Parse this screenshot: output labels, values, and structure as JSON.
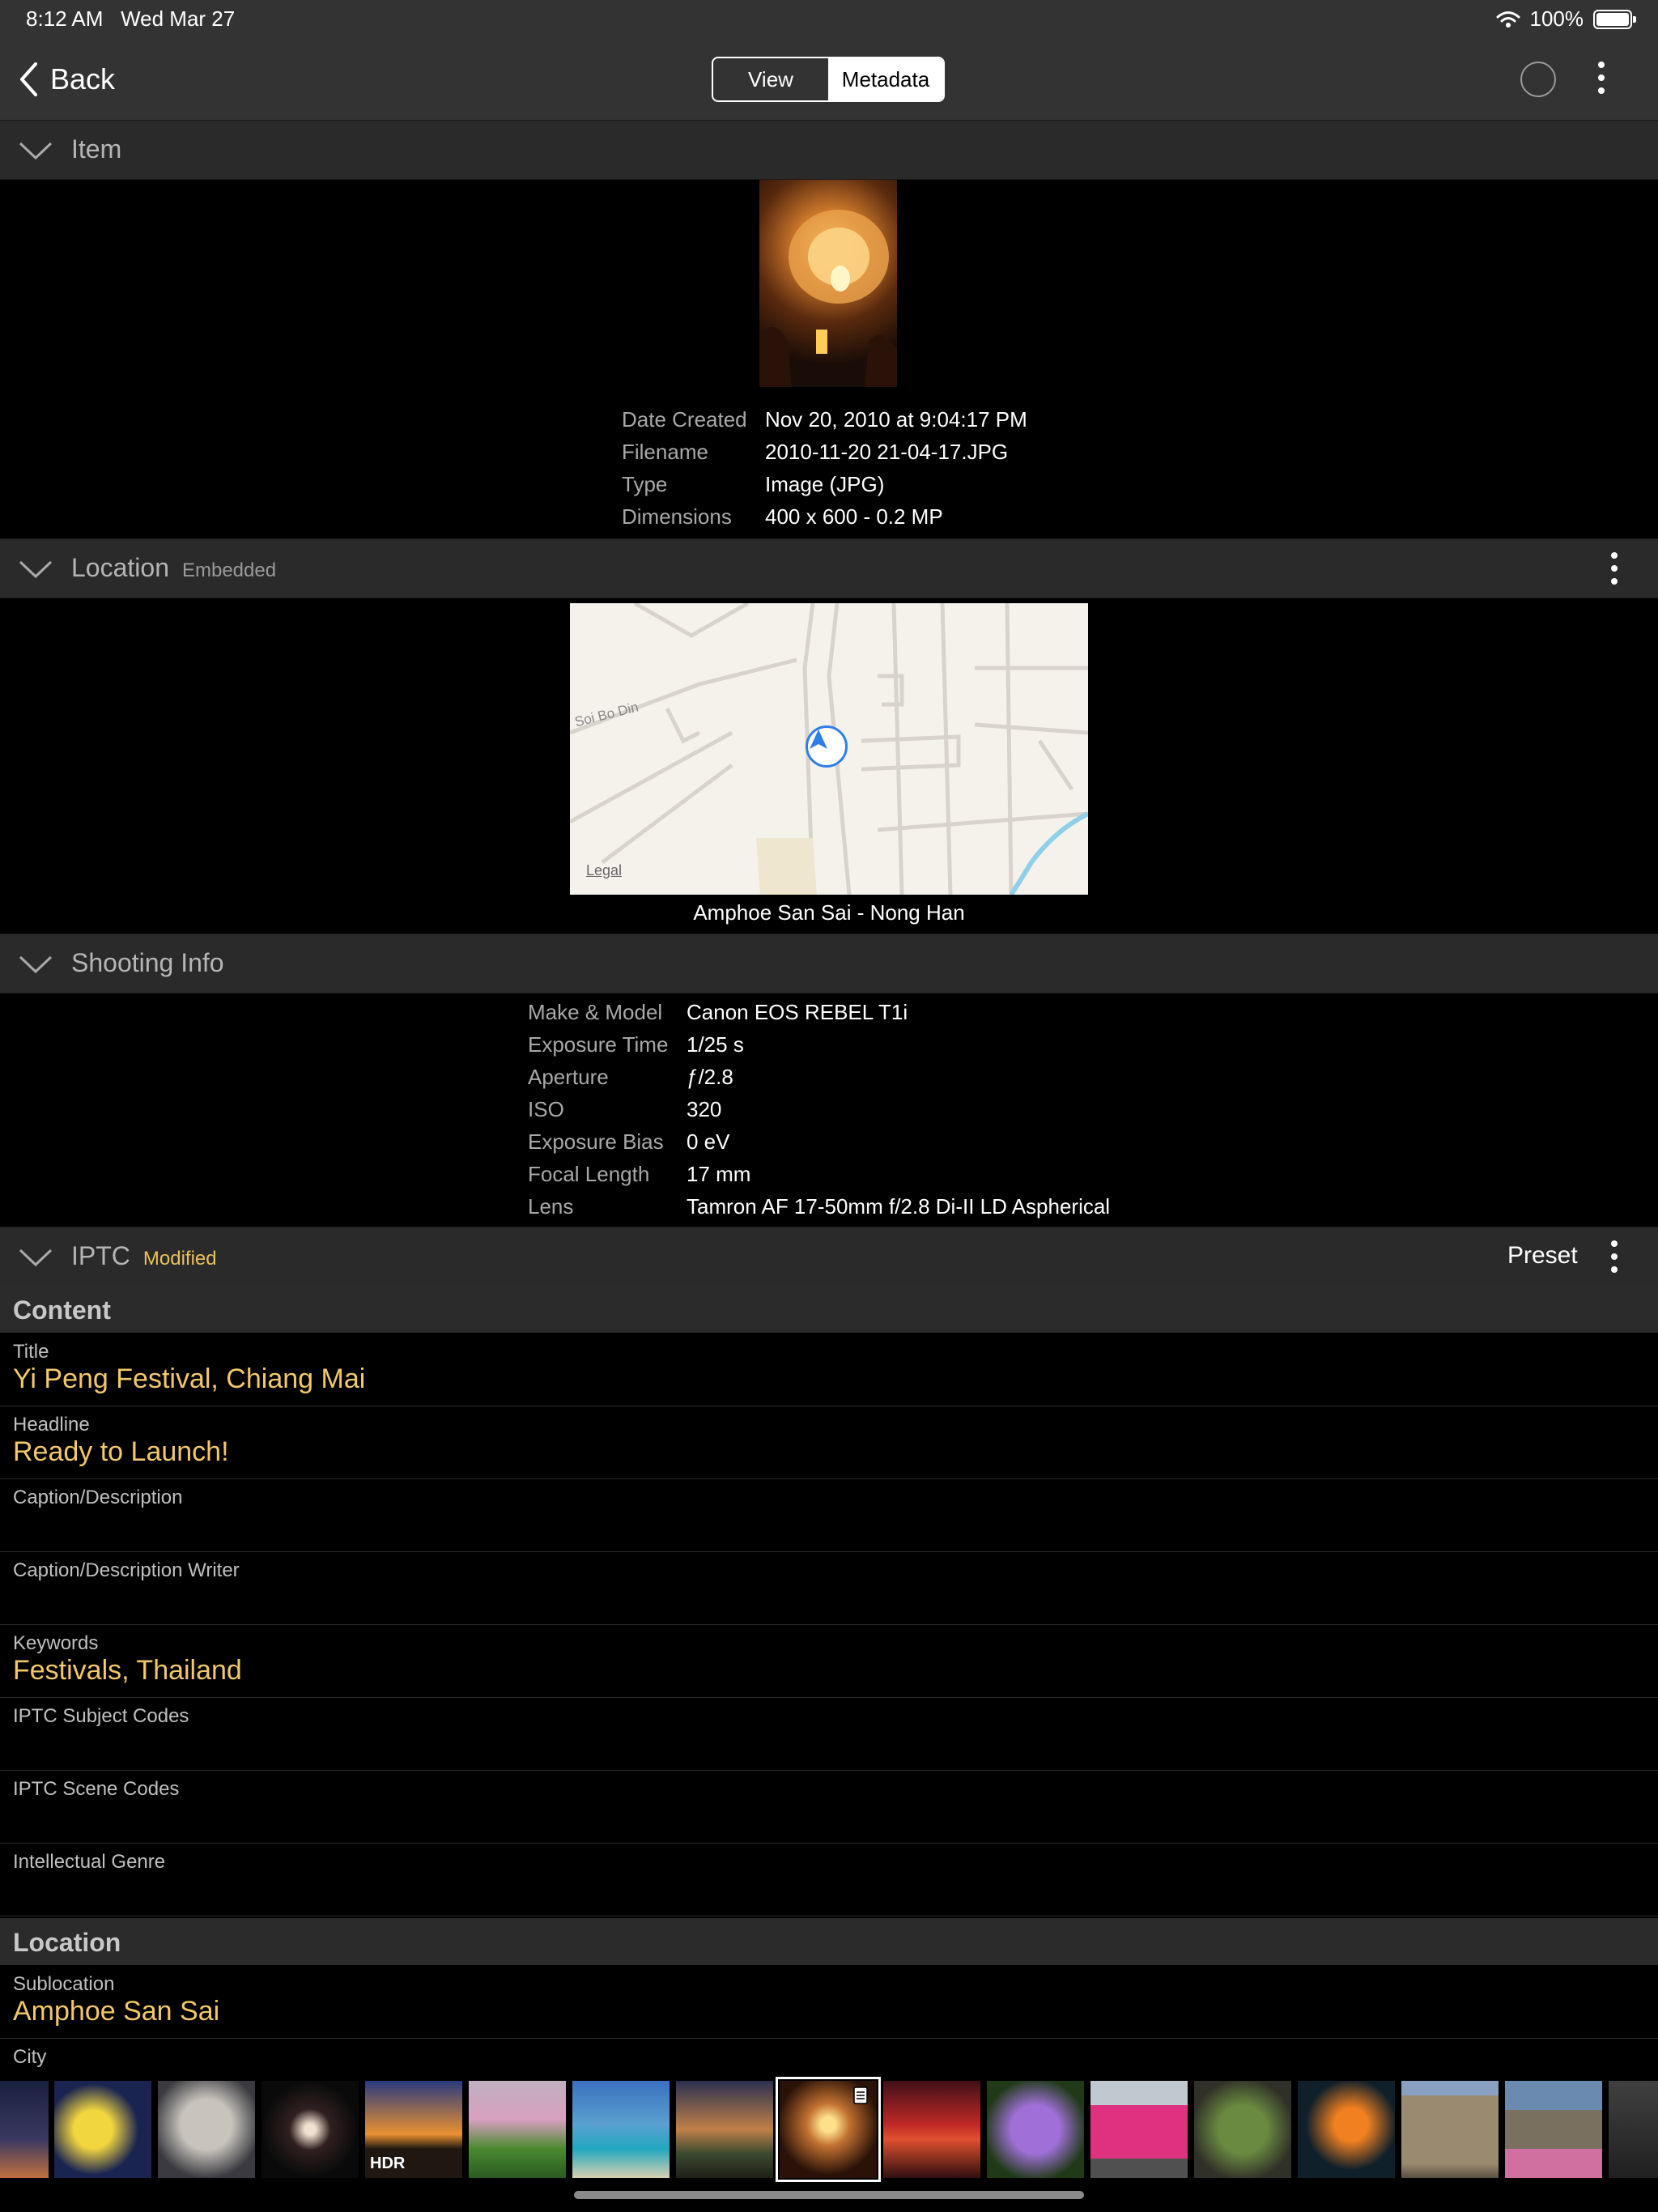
{
  "status_bar": {
    "time": "8:12 AM",
    "date": "Wed Mar 27",
    "battery": "100%"
  },
  "nav": {
    "back_label": "Back",
    "tabs": [
      "View",
      "Metadata"
    ],
    "active_tab": "Metadata"
  },
  "item_section": {
    "title": "Item",
    "rows": [
      {
        "key": "Date Created",
        "value": "Nov 20, 2010 at 9:04:17 PM"
      },
      {
        "key": "Filename",
        "value": "2010-11-20 21-04-17.JPG"
      },
      {
        "key": "Type",
        "value": "Image (JPG)"
      },
      {
        "key": "Dimensions",
        "value": "400 x 600 - 0.2 MP"
      }
    ]
  },
  "location_section": {
    "title": "Location",
    "badge": "Embedded",
    "map_street": "Soi Bo Din",
    "map_legal": "Legal",
    "place": "Amphoe San Sai - Nong Han"
  },
  "shooting_section": {
    "title": "Shooting Info",
    "rows": [
      {
        "key": "Make & Model",
        "value": "Canon EOS REBEL T1i"
      },
      {
        "key": "Exposure Time",
        "value": "1/25 s"
      },
      {
        "key": "Aperture",
        "value": "ƒ/2.8"
      },
      {
        "key": "ISO",
        "value": "320"
      },
      {
        "key": "Exposure Bias",
        "value": "0 eV"
      },
      {
        "key": "Focal Length",
        "value": "17 mm"
      },
      {
        "key": "Lens",
        "value": "Tamron AF 17-50mm f/2.8 Di-II LD Aspherical"
      }
    ]
  },
  "iptc_section": {
    "title": "IPTC",
    "badge": "Modified",
    "preset_label": "Preset",
    "groups": [
      {
        "name": "Content",
        "fields": [
          {
            "label": "Title",
            "value": "Yi Peng Festival, Chiang Mai"
          },
          {
            "label": "Headline",
            "value": "Ready to Launch!"
          },
          {
            "label": "Caption/Description",
            "value": ""
          },
          {
            "label": "Caption/Description Writer",
            "value": ""
          },
          {
            "label": "Keywords",
            "value": "Festivals, Thailand"
          },
          {
            "label": "IPTC Subject Codes",
            "value": ""
          },
          {
            "label": "IPTC Scene Codes",
            "value": ""
          },
          {
            "label": "Intellectual Genre",
            "value": ""
          }
        ]
      },
      {
        "name": "Location",
        "fields": [
          {
            "label": "Sublocation",
            "value": "Amphoe San Sai"
          },
          {
            "label": "City",
            "value": ""
          }
        ]
      }
    ]
  },
  "filmstrip": {
    "thumbnails": [
      {
        "name": "city-night",
        "badge": ""
      },
      {
        "name": "yellow-flowers",
        "badge": ""
      },
      {
        "name": "owl",
        "badge": ""
      },
      {
        "name": "light-painting",
        "badge": ""
      },
      {
        "name": "sunset-hdr",
        "badge": "HDR"
      },
      {
        "name": "cherry-tree",
        "badge": ""
      },
      {
        "name": "beach-cliffs",
        "badge": ""
      },
      {
        "name": "dusk-path",
        "badge": ""
      },
      {
        "name": "sky-lantern",
        "badge": ""
      },
      {
        "name": "red-sunset",
        "badge": ""
      },
      {
        "name": "purple-flowers",
        "badge": ""
      },
      {
        "name": "pink-house",
        "badge": ""
      },
      {
        "name": "mossy-statue",
        "badge": ""
      },
      {
        "name": "goldfish",
        "badge": ""
      },
      {
        "name": "cathedral",
        "badge": ""
      },
      {
        "name": "garden-house",
        "badge": ""
      },
      {
        "name": "partial",
        "badge": ""
      }
    ],
    "selected_index": 8
  },
  "colors": {
    "accent_value": "#f2c86a",
    "header_bg": "#2a2a2a",
    "nav_bg": "#333333",
    "map_pin": "#2f7ee8"
  }
}
